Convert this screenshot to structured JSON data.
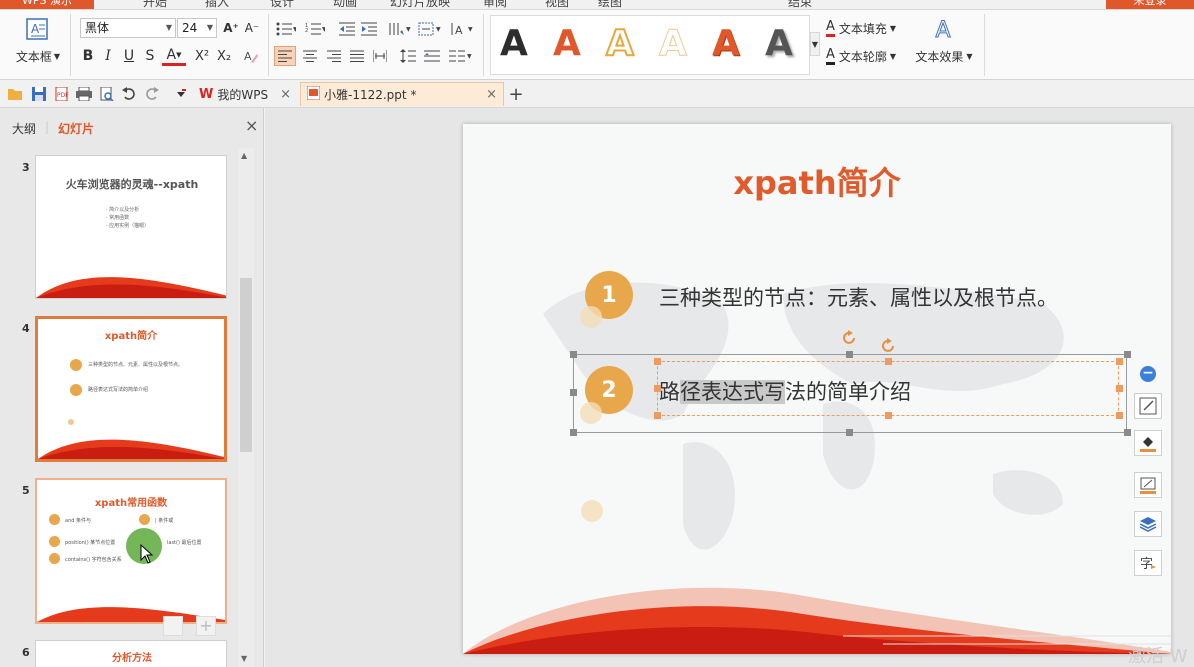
{
  "menubar": {
    "app_button": "WPS 演示",
    "tabs": [
      "开始",
      "插入",
      "设计",
      "动画",
      "幻灯片放映",
      "审阅",
      "视图",
      "绘图",
      "",
      "",
      "",
      "结束"
    ],
    "login": "未登录"
  },
  "ribbon": {
    "textbox_label": "文本框",
    "font_name": "黑体",
    "font_size": "24",
    "grow_font": "A⁺",
    "shrink_font": "A⁻",
    "bold": "B",
    "italic": "I",
    "underline": "U",
    "strike": "S",
    "font_color": "A",
    "superscript": "X²",
    "subscript": "X₂",
    "text_fill": "文本填充",
    "text_outline": "文本轮廓",
    "text_effect": "文本效果",
    "style_letter": "A"
  },
  "quickbar": {
    "tabs": [
      {
        "label": "我的WPS",
        "active": false
      },
      {
        "label": "小雅-1122.ppt *",
        "active": true
      }
    ],
    "new_tab": "+"
  },
  "leftpanel": {
    "tab_outline": "大纲",
    "tab_slides": "幻灯片",
    "close": "×",
    "slides": [
      {
        "num": "3",
        "title": "火车浏览器的灵魂--xpath",
        "bullets": [
          "· 简介以及分析",
          "· 常用函数",
          "· 应用实例（猫眼）"
        ]
      },
      {
        "num": "4",
        "title": "xpath简介",
        "bullets": [
          "三种类型的节点、元素、属性以及根节点。",
          "路径表达式写法的简单介绍"
        ]
      },
      {
        "num": "5",
        "title": "xpath常用函数",
        "bullets": [
          "and 条件与",
          "| 条件或",
          "position() 某节点位置",
          "last() 最后位置",
          "contains() 字符包含关系"
        ]
      },
      {
        "num": "6",
        "title": "分析方法",
        "bullets": []
      }
    ]
  },
  "slide": {
    "title": "xpath简介",
    "item1_num": "1",
    "item1_text": "三种类型的节点：元素、属性以及根节点。",
    "item2_num": "2",
    "item2_text_pre": "路",
    "item2_text_sel": "径表达式写",
    "item2_text_post": "法的简单介绍"
  },
  "watermark": "激活 W",
  "colors": {
    "accent": "#e0582a",
    "title": "#e05a2b",
    "circle": "#e8a74a"
  }
}
